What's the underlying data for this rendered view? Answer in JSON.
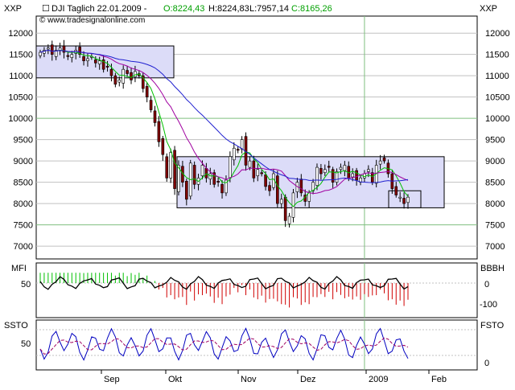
{
  "header": {
    "left_axis_label": "XXP",
    "right_axis_label": "XXP",
    "checkbox_symbol": "☐",
    "title_prefix": "DJI Taglich  22.01.2009 - ",
    "ohlc": {
      "open": "O:8224,43",
      "high": "H:8224,83",
      "low": "L:7957,14",
      "close": "C:8165,26"
    },
    "copyright": "© www.tradesignalonline.com"
  },
  "colors": {
    "open": "#00a000",
    "close": "#00a000",
    "high": "#000000",
    "low": "#000000",
    "ma_green": "#00c000",
    "ma_purple": "#a000a0",
    "ma_blue": "#2020d0",
    "candle_up": "#ffffff",
    "candle_down": "#800000",
    "box_fill": "#dcdcf8",
    "mfi_pos": "#00c000",
    "mfi_neg": "#d00000",
    "sto_k": "#0000c0",
    "sto_d": "#a00060",
    "grid": "#c0c0c0",
    "grid_v": "#7fbf7f"
  },
  "x_axis": {
    "labels": [
      "Sep",
      "Okt",
      "Nov",
      "Dez",
      "2009",
      "Feb"
    ]
  },
  "panels": {
    "mfi": {
      "left_label": "MFI",
      "right_label": "BBBH",
      "left_ticks": [
        "50"
      ],
      "right_ticks": [
        "0",
        "-100"
      ]
    },
    "sto": {
      "left_label": "SSTO",
      "right_label": "FSTO",
      "left_ticks": [
        "50"
      ],
      "right_ticks": [
        "0"
      ]
    }
  },
  "chart_data": [
    {
      "type": "candlestick",
      "y_ticks": [
        "12000",
        "11500",
        "11000",
        "10500",
        "10000",
        "9500",
        "9000",
        "8500",
        "8000",
        "7500",
        "7000"
      ],
      "ylim": [
        6700,
        12400
      ],
      "x_categories": [
        "Sep",
        "Okt",
        "Nov",
        "Dez",
        "2009",
        "Feb"
      ],
      "close_series": [
        11550,
        11600,
        11650,
        11500,
        11600,
        11650,
        11550,
        11450,
        11500,
        11600,
        11500,
        11350,
        11400,
        11450,
        11300,
        11350,
        11150,
        11200,
        11000,
        10800,
        10900,
        11150,
        11050,
        10900,
        11100,
        11000,
        10700,
        10500,
        10200,
        9900,
        9450,
        9150,
        8600,
        9200,
        8350,
        8900,
        8500,
        8100,
        8950,
        8450,
        8600,
        8900,
        8600,
        8700,
        8450,
        8500,
        8250,
        8550,
        9100,
        9300,
        9250,
        9500,
        8900,
        9000,
        8600,
        8800,
        8700,
        8400,
        8300,
        8700,
        8000,
        8100,
        7600,
        7700,
        8250,
        8500,
        8250,
        8050,
        8250,
        8500,
        8850,
        8700,
        8800,
        8850,
        8500,
        8750,
        8850,
        8900,
        8600,
        8700,
        8550,
        8600,
        8700,
        8800,
        8500,
        8900,
        9000,
        9000,
        8700,
        8350,
        8200,
        8150,
        8000,
        8150
      ]
    },
    {
      "type": "bar",
      "name": "MFI",
      "y_ticks": [
        "50"
      ]
    },
    {
      "type": "line",
      "name": "SSTO",
      "y_ticks": [
        "50"
      ]
    }
  ]
}
